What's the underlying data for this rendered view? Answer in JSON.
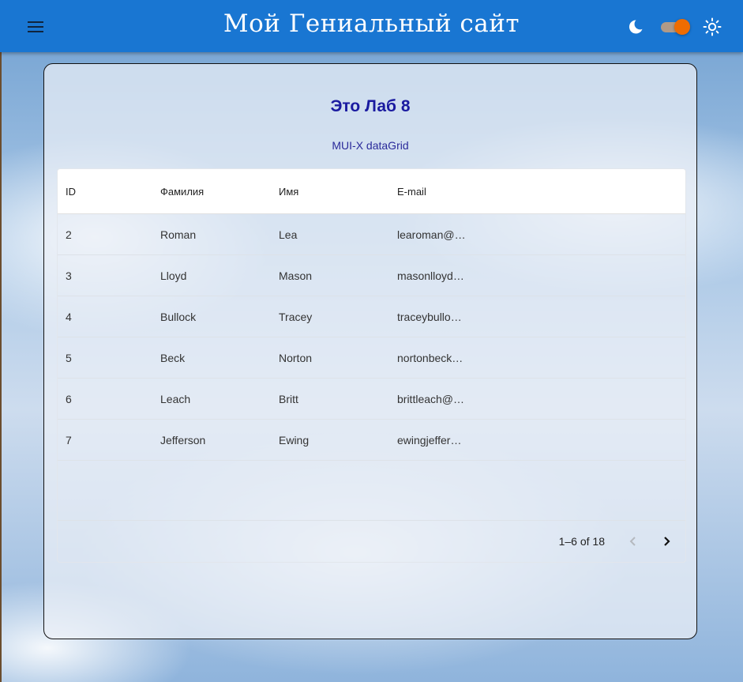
{
  "app": {
    "title": "Мой Гениальный сайт",
    "icons": {
      "menu": "menu-icon",
      "dark_mode": "moon-icon",
      "light_mode": "sun-icon"
    },
    "theme_toggle": {
      "checked": true,
      "accent": "#ef6c00"
    },
    "colors": {
      "appbar": "#1976d2",
      "title_text": "#1a1aa0"
    }
  },
  "card": {
    "title": "Это Лаб 8",
    "subtitle": "MUI-X dataGrid"
  },
  "grid": {
    "columns": [
      "ID",
      "Фамилия",
      "Имя",
      "E-mail"
    ],
    "rows": [
      [
        "2",
        "Roman",
        "Lea",
        "learoman@…"
      ],
      [
        "3",
        "Lloyd",
        "Mason",
        "masonlloyd…"
      ],
      [
        "4",
        "Bullock",
        "Tracey",
        "traceybullo…"
      ],
      [
        "5",
        "Beck",
        "Norton",
        "nortonbeck…"
      ],
      [
        "6",
        "Leach",
        "Britt",
        "brittleach@…"
      ],
      [
        "7",
        "Jefferson",
        "Ewing",
        "ewingjeffer…"
      ]
    ],
    "pagination": {
      "label": "1–6 of 18",
      "prev_icon": "chevron-left-icon",
      "next_icon": "chevron-right-icon"
    }
  }
}
